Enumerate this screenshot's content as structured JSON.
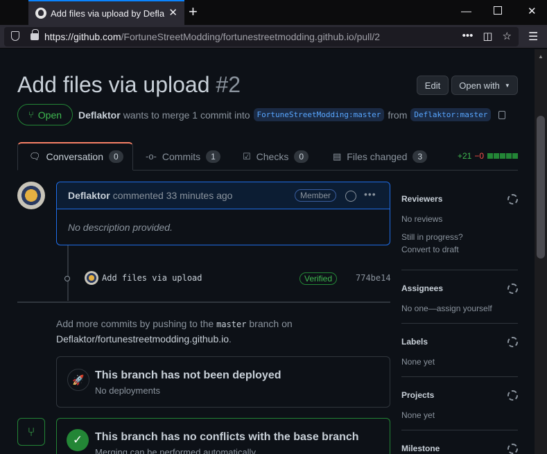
{
  "browser": {
    "tab_title": "Add files via upload by Deflaktor",
    "url_host": "https://github.com",
    "url_path": "/FortuneStreetModding/fortunestreetmodding.github.io/pull/2"
  },
  "pr": {
    "title": "Add files via upload",
    "number": "#2",
    "edit_label": "Edit",
    "open_with_label": "Open with",
    "state": "Open",
    "author": "Deflaktor",
    "merge_text": "wants to merge 1 commit into",
    "base_branch": "FortuneStreetModding:master",
    "from_text": "from",
    "head_branch": "Deflaktor:master"
  },
  "tabs": [
    {
      "label": "Conversation",
      "count": "0",
      "icon": "comment-icon"
    },
    {
      "label": "Commits",
      "count": "1",
      "icon": "commit-icon"
    },
    {
      "label": "Checks",
      "count": "0",
      "icon": "checklist-icon"
    },
    {
      "label": "Files changed",
      "count": "3",
      "icon": "file-diff-icon"
    }
  ],
  "diffstat": {
    "additions": "+21",
    "deletions": "−0"
  },
  "comment": {
    "author": "Deflaktor",
    "action": "commented 33 minutes ago",
    "badge": "Member",
    "body": "No description provided."
  },
  "commit": {
    "message": "Add files via upload",
    "verified": "Verified",
    "sha": "774be14"
  },
  "hint": {
    "prefix": "Add more commits by pushing to the",
    "branch": "master",
    "mid": "branch on",
    "repo": "Deflaktor/fortunestreetmodding.github.io",
    "suffix": "."
  },
  "deploy": {
    "title": "This branch has not been deployed",
    "sub": "No deployments"
  },
  "merge": {
    "title": "This branch has no conflicts with the base branch",
    "sub": "Merging can be performed automatically."
  },
  "sidebar": {
    "reviewers_title": "Reviewers",
    "reviewers_value": "No reviews",
    "in_progress": "Still in progress?",
    "convert_draft": "Convert to draft",
    "assignees_title": "Assignees",
    "assignees_value": "No one—assign yourself",
    "labels_title": "Labels",
    "labels_value": "None yet",
    "projects_title": "Projects",
    "projects_value": "None yet",
    "milestone_title": "Milestone"
  }
}
